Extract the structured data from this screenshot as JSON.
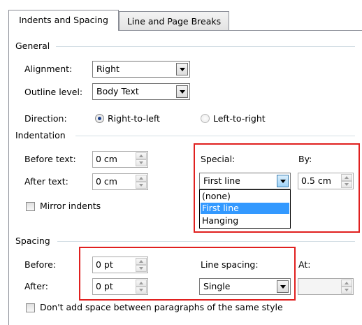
{
  "tabs": [
    {
      "label": "Indents and Spacing",
      "active": true
    },
    {
      "label": "Line and Page Breaks",
      "active": false
    }
  ],
  "general": {
    "heading": "General",
    "alignment_label": "Alignment:",
    "alignment_value": "Right",
    "outline_label": "Outline level:",
    "outline_value": "Body Text",
    "direction_label": "Direction:",
    "direction_rtl": "Right-to-left",
    "direction_ltr": "Left-to-right",
    "direction_selected": "Right-to-left"
  },
  "indentation": {
    "heading": "Indentation",
    "before_label": "Before text:",
    "before_value": "0 cm",
    "after_label": "After text:",
    "after_value": "0 cm",
    "mirror_label": "Mirror indents",
    "special_label": "Special:",
    "special_value": "First line",
    "by_label": "By:",
    "by_value": "0.5 cm",
    "special_options": [
      "(none)",
      "First line",
      "Hanging"
    ]
  },
  "spacing": {
    "heading": "Spacing",
    "before_label": "Before:",
    "before_value": "0 pt",
    "after_label": "After:",
    "after_value": "0 pt",
    "line_spacing_label": "Line spacing:",
    "line_spacing_value": "Single",
    "at_label": "At:",
    "at_value": "",
    "dont_add_label": "Don't add space between paragraphs of the same style"
  },
  "colors": {
    "highlight_box": "#e0201f",
    "selection": "#3399ff"
  }
}
